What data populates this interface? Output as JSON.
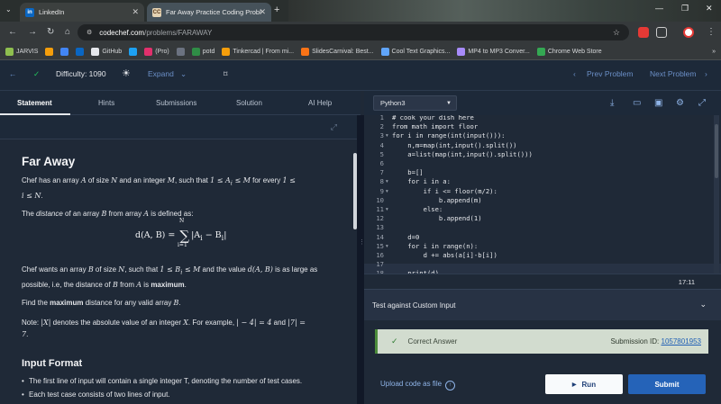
{
  "browser": {
    "tabs": [
      {
        "title": "LinkedIn",
        "favicon": "in",
        "active": false
      },
      {
        "title": "Far Away Practice Coding Probl",
        "favicon": "CC",
        "active": true
      }
    ],
    "url_host": "codechef.com",
    "url_path": "/problems/FARAWAY",
    "bookmarks": [
      {
        "label": "JARVIS",
        "color": "#8fbf4f"
      },
      {
        "label": "",
        "color": "#f59e0b"
      },
      {
        "label": "",
        "color": "#4285f4"
      },
      {
        "label": "",
        "color": "#0a66c2"
      },
      {
        "label": "GitHub",
        "color": "#e5e7eb"
      },
      {
        "label": "",
        "color": "#1da1f2"
      },
      {
        "label": "(Pro)",
        "color": "#e1306c"
      },
      {
        "label": "",
        "color": "#6b7280"
      },
      {
        "label": "potd",
        "color": "#2f8d46"
      },
      {
        "label": "Tinkercad | From mi...",
        "color": "#f59e0b"
      },
      {
        "label": "SlidesCarnival: Best...",
        "color": "#f97316"
      },
      {
        "label": "Cool Text Graphics...",
        "color": "#60a5fa"
      },
      {
        "label": "MP4 to MP3 Conver...",
        "color": "#a78bfa"
      },
      {
        "label": "Chrome Web Store",
        "color": "#34a853"
      }
    ]
  },
  "toolbar": {
    "difficulty": "Difficulty: 1090",
    "expand": "Expand",
    "prev": "Prev Problem",
    "next": "Next Problem"
  },
  "tabs": {
    "statement": "Statement",
    "hints": "Hints",
    "submissions": "Submissions",
    "solution": "Solution",
    "ai_help": "AI Help"
  },
  "editor": {
    "language": "Python3",
    "cursor": "17:11",
    "lines": [
      {
        "n": "1",
        "code": "# cook your dish here",
        "fold": false
      },
      {
        "n": "2",
        "code": "from math import floor",
        "fold": false
      },
      {
        "n": "3",
        "code": "for i in range(int(input())):",
        "fold": true
      },
      {
        "n": "4",
        "code": "    n,m=map(int,input().split())",
        "fold": false
      },
      {
        "n": "5",
        "code": "    a=list(map(int,input().split()))",
        "fold": false
      },
      {
        "n": "6",
        "code": "",
        "fold": false
      },
      {
        "n": "7",
        "code": "    b=[]",
        "fold": false
      },
      {
        "n": "8",
        "code": "    for i in a:",
        "fold": true
      },
      {
        "n": "9",
        "code": "        if i <= floor(m/2):",
        "fold": true
      },
      {
        "n": "10",
        "code": "            b.append(m)",
        "fold": false
      },
      {
        "n": "11",
        "code": "        else:",
        "fold": true
      },
      {
        "n": "12",
        "code": "            b.append(1)",
        "fold": false
      },
      {
        "n": "13",
        "code": "",
        "fold": false
      },
      {
        "n": "14",
        "code": "    d=0",
        "fold": false
      },
      {
        "n": "15",
        "code": "    for i in range(n):",
        "fold": true
      },
      {
        "n": "16",
        "code": "        d += abs(a[i]-b[i])",
        "fold": false
      },
      {
        "n": "17",
        "code": "",
        "fold": false
      },
      {
        "n": "18",
        "code": "    print(d)",
        "fold": false
      }
    ]
  },
  "problem": {
    "title": "Far Away",
    "input_format_heading": "Input Format",
    "input_format_items": [
      "The first line of input will contain a single integer T, denoting the number of test cases.",
      "Each test case consists of two lines of input."
    ]
  },
  "custom_input": {
    "label": "Test against Custom Input"
  },
  "result": {
    "status": "Correct Answer",
    "submission_label": "Submission ID:",
    "submission_id": "1057801953",
    "color": "#d2dccf"
  },
  "actions": {
    "upload": "Upload code as file",
    "run": "Run",
    "submit": "Submit"
  }
}
